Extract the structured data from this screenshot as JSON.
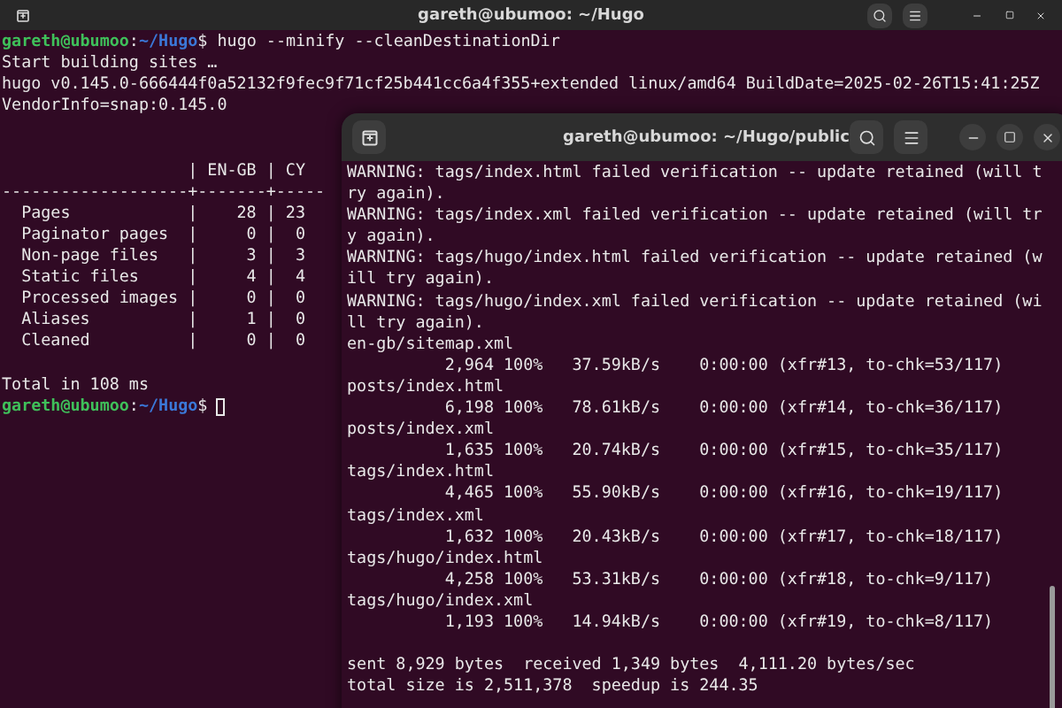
{
  "back_window": {
    "title": "gareth@ubumoo: ~/Hugo",
    "lines": [
      {
        "kind": "prompt",
        "user": "gareth@ubumoo",
        "sep": ":",
        "path": "~/Hugo",
        "end": "$",
        "command": "hugo --minify --cleanDestinationDir"
      },
      {
        "kind": "output",
        "text": "Start building sites … "
      },
      {
        "kind": "output",
        "text": "hugo v0.145.0-666444f0a52132f9fec9f71cf25b441cc6a4f355+extended linux/amd64 BuildDate=2025-02-26T15:41:25Z"
      },
      {
        "kind": "output",
        "text": "VendorInfo=snap:0.145.0"
      },
      {
        "kind": "blank"
      },
      {
        "kind": "blank"
      },
      {
        "kind": "output",
        "text": "                   | EN-GB | CY"
      },
      {
        "kind": "output",
        "text": "-------------------+-------+-----"
      },
      {
        "kind": "output",
        "text": "  Pages            |    28 | 23"
      },
      {
        "kind": "output",
        "text": "  Paginator pages  |     0 |  0"
      },
      {
        "kind": "output",
        "text": "  Non-page files   |     3 |  3"
      },
      {
        "kind": "output",
        "text": "  Static files     |     4 |  4"
      },
      {
        "kind": "output",
        "text": "  Processed images |     0 |  0"
      },
      {
        "kind": "output",
        "text": "  Aliases          |     1 |  0"
      },
      {
        "kind": "output",
        "text": "  Cleaned          |     0 |  0"
      },
      {
        "kind": "blank"
      },
      {
        "kind": "output",
        "text": "Total in 108 ms"
      },
      {
        "kind": "prompt",
        "user": "gareth@ubumoo",
        "sep": ":",
        "path": "~/Hugo",
        "end": "$",
        "cursor_focused": false
      }
    ]
  },
  "front_window": {
    "title": "gareth@ubumoo: ~/Hugo/public",
    "lines": [
      {
        "kind": "output",
        "text": "WARNING: tags/index.html failed verification -- update retained (will t"
      },
      {
        "kind": "output",
        "text": "ry again)."
      },
      {
        "kind": "output",
        "text": "WARNING: tags/index.xml failed verification -- update retained (will tr"
      },
      {
        "kind": "output",
        "text": "y again)."
      },
      {
        "kind": "output",
        "text": "WARNING: tags/hugo/index.html failed verification -- update retained (w"
      },
      {
        "kind": "output",
        "text": "ill try again)."
      },
      {
        "kind": "output",
        "text": "WARNING: tags/hugo/index.xml failed verification -- update retained (wi"
      },
      {
        "kind": "output",
        "text": "ll try again)."
      },
      {
        "kind": "output",
        "text": "en-gb/sitemap.xml"
      },
      {
        "kind": "output",
        "text": "          2,964 100%   37.59kB/s    0:00:00 (xfr#13, to-chk=53/117)"
      },
      {
        "kind": "output",
        "text": "posts/index.html"
      },
      {
        "kind": "output",
        "text": "          6,198 100%   78.61kB/s    0:00:00 (xfr#14, to-chk=36/117)"
      },
      {
        "kind": "output",
        "text": "posts/index.xml"
      },
      {
        "kind": "output",
        "text": "          1,635 100%   20.74kB/s    0:00:00 (xfr#15, to-chk=35/117)"
      },
      {
        "kind": "output",
        "text": "tags/index.html"
      },
      {
        "kind": "output",
        "text": "          4,465 100%   55.90kB/s    0:00:00 (xfr#16, to-chk=19/117)"
      },
      {
        "kind": "output",
        "text": "tags/index.xml"
      },
      {
        "kind": "output",
        "text": "          1,632 100%   20.43kB/s    0:00:00 (xfr#17, to-chk=18/117)"
      },
      {
        "kind": "output",
        "text": "tags/hugo/index.html"
      },
      {
        "kind": "output",
        "text": "          4,258 100%   53.31kB/s    0:00:00 (xfr#18, to-chk=9/117)"
      },
      {
        "kind": "output",
        "text": "tags/hugo/index.xml"
      },
      {
        "kind": "output",
        "text": "          1,193 100%   14.94kB/s    0:00:00 (xfr#19, to-chk=8/117)"
      },
      {
        "kind": "blank"
      },
      {
        "kind": "output",
        "text": "sent 8,929 bytes  received 1,349 bytes  4,111.20 bytes/sec"
      },
      {
        "kind": "output",
        "text": "total size is 2,511,378  speedup is 244.35"
      }
    ]
  }
}
